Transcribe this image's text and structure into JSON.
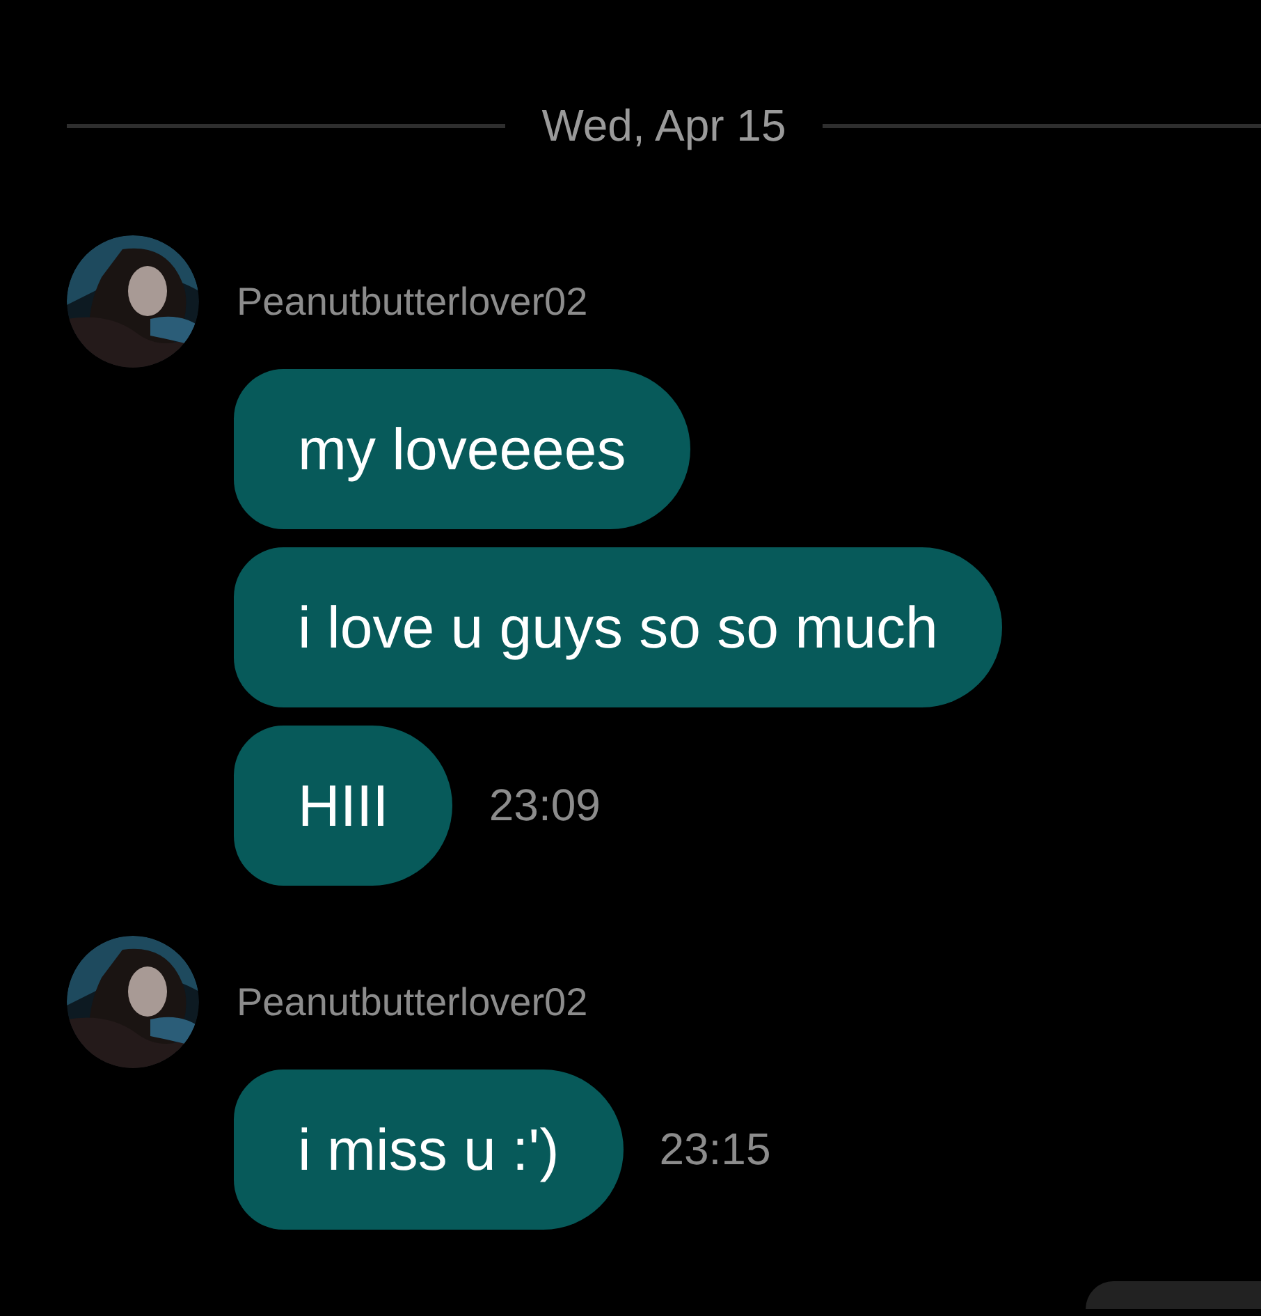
{
  "date_divider": "Wed, Apr 15",
  "groups": [
    {
      "sender": "Peanutbutterlover02",
      "avatar": {
        "kind": "picture"
      },
      "messages": [
        {
          "text": "my loveeees"
        },
        {
          "text": "i love u guys so so much"
        },
        {
          "text": "HIII",
          "time": "23:09"
        }
      ]
    },
    {
      "sender": "Peanutbutterlover02",
      "avatar": {
        "kind": "picture"
      },
      "messages": [
        {
          "text": "i miss u :')",
          "time": "23:15"
        }
      ]
    }
  ]
}
